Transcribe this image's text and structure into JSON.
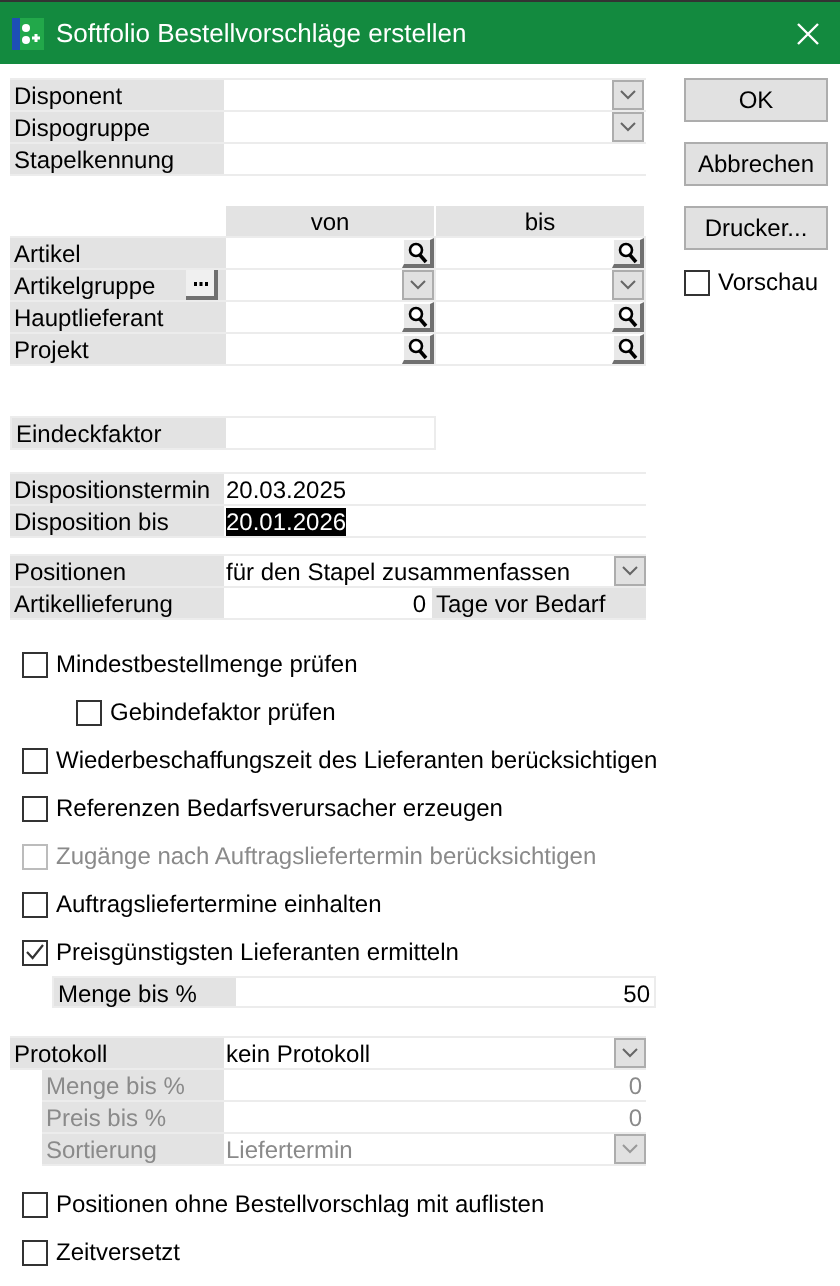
{
  "window": {
    "title": "Softfolio Bestellvorschläge erstellen"
  },
  "header_fields": [
    {
      "label": "Disponent",
      "kind": "dropdown"
    },
    {
      "label": "Dispogruppe",
      "kind": "dropdown"
    },
    {
      "label": "Stapelkennung",
      "kind": "text"
    }
  ],
  "range": {
    "columns": [
      "von",
      "bis"
    ],
    "rows": [
      {
        "label": "Artikel",
        "kind": "lookup",
        "ellipsis": false
      },
      {
        "label": "Artikelgruppe",
        "kind": "dropdown",
        "ellipsis": true
      },
      {
        "label": "Hauptlieferant",
        "kind": "lookup",
        "ellipsis": false
      },
      {
        "label": "Projekt",
        "kind": "lookup",
        "ellipsis": false
      }
    ]
  },
  "eindeckfaktor": {
    "label": "Eindeckfaktor"
  },
  "dates": [
    {
      "label": "Dispositionstermin",
      "value": "20.03.2025",
      "selected": false
    },
    {
      "label": "Disposition bis",
      "value": "20.01.2026",
      "selected": true
    }
  ],
  "positionen": {
    "label": "Positionen",
    "value": "für den Stapel zusammenfassen"
  },
  "artikellieferung": {
    "label": "Artikellieferung",
    "value": "0",
    "suffix": "Tage vor Bedarf"
  },
  "options": [
    {
      "label": "Mindestbestellmenge prüfen",
      "checked": false,
      "disabled": false,
      "children": [
        {
          "label": "Gebindefaktor prüfen",
          "checked": false,
          "disabled": false
        }
      ]
    },
    {
      "label": "Wiederbeschaffungszeit des Lieferanten berücksichtigen",
      "checked": false,
      "disabled": false
    },
    {
      "label": "Referenzen Bedarfsverursacher erzeugen",
      "checked": false,
      "disabled": false
    },
    {
      "label": "Zugänge nach Auftragsliefertermin berücksichtigen",
      "checked": false,
      "disabled": true
    },
    {
      "label": "Auftragsliefertermine einhalten",
      "checked": false,
      "disabled": false
    },
    {
      "label": "Preisgünstigsten Lieferanten ermitteln",
      "checked": true,
      "disabled": false,
      "field": {
        "label": "Menge bis %",
        "value": "50"
      }
    }
  ],
  "protokoll": {
    "label": "Protokoll",
    "value": "kein Protokoll",
    "sub_fields": [
      {
        "label": "Menge bis %",
        "value": "0",
        "kind": "number",
        "disabled": true
      },
      {
        "label": "Preis bis %",
        "value": "0",
        "kind": "number",
        "disabled": true
      },
      {
        "label": "Sortierung",
        "value": "Liefertermin",
        "kind": "dropdown",
        "disabled": true
      }
    ]
  },
  "final_options": [
    {
      "label": "Positionen ohne Bestellvorschlag mit auflisten",
      "checked": false,
      "disabled": false
    },
    {
      "label": "Zeitversetzt",
      "checked": false,
      "disabled": false
    }
  ],
  "buttons": [
    "OK",
    "Abbrechen",
    "Drucker..."
  ],
  "vorschau": {
    "label": "Vorschau",
    "checked": false
  }
}
